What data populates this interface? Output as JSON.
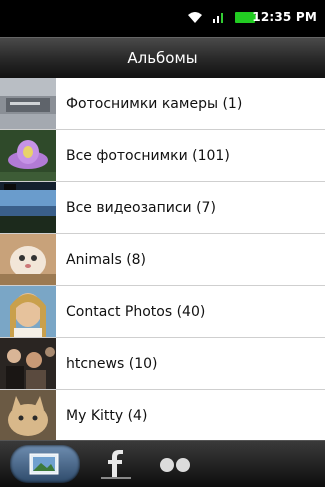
{
  "status_bar": {
    "time": "12:35 PM"
  },
  "title": "Альбомы",
  "albums": [
    {
      "label": "Фотоснимки камеры (1)",
      "thumb": "camera-shots-thumb"
    },
    {
      "label": "Все фотоснимки (101)",
      "thumb": "flower-thumb"
    },
    {
      "label": "Все видеозаписи (7)",
      "thumb": "landscape-thumb"
    },
    {
      "label": "Animals (8)",
      "thumb": "cat-face-thumb"
    },
    {
      "label": "Contact Photos (40)",
      "thumb": "person-thumb"
    },
    {
      "label": "htcnews (10)",
      "thumb": "crowd-thumb"
    },
    {
      "label": "My Kitty (4)",
      "thumb": "kitty-thumb"
    }
  ],
  "tabs": [
    {
      "icon": "gallery-icon",
      "active": true
    },
    {
      "icon": "facebook-icon",
      "active": false
    },
    {
      "icon": "flickr-icon",
      "active": false
    }
  ],
  "colors": {
    "status_bar": "#000000",
    "title_bar": "#2a2a2a",
    "active_tab": "#4a6a8e"
  }
}
